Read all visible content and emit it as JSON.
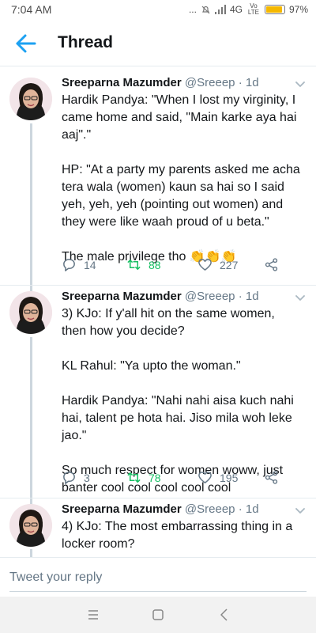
{
  "status_bar": {
    "time": "7:04 AM",
    "indicators": "... ",
    "network": "4G",
    "volte": "Vo LTE",
    "battery_percent": "97%",
    "battery_level": 0.97
  },
  "header": {
    "title": "Thread",
    "back_icon": "arrow-left-icon"
  },
  "tweets": [
    {
      "name": "Sreeparna Mazumder",
      "handle": "@Sreeep",
      "time": "· 1d",
      "paragraphs": [
        "Hardik Pandya: \"When I lost my virginity, I came home and said, \"Main karke aya hai aaj\".\"",
        "HP: \"At a party my parents asked me acha tera wala (women) kaun sa hai so I said yeh, yeh, yeh (pointing out women) and they were like waah proud of u beta.\"",
        "The male privilege tho 👏👏👏"
      ],
      "replies": "14",
      "retweets": "88",
      "likes": "227"
    },
    {
      "name": "Sreeparna Mazumder",
      "handle": "@Sreeep",
      "time": "· 1d",
      "paragraphs": [
        "3) KJo: If y'all hit on the same women, then how you decide?",
        "KL Rahul: \"Ya upto the woman.\"",
        "Hardik Pandya: \"Nahi nahi aisa kuch nahi hai, talent pe hota hai. Jiso mila woh leke jao.\"",
        "So much respect for women woww, just banter cool cool cool cool cool"
      ],
      "replies": "3",
      "retweets": "78",
      "likes": "195"
    },
    {
      "name": "Sreeparna Mazumder",
      "handle": "@Sreeep",
      "time": "· 1d",
      "paragraphs": [
        "4) KJo: The most embarrassing thing in a locker room?"
      ]
    }
  ],
  "reply_box": {
    "placeholder": "Tweet your reply"
  },
  "colors": {
    "accent": "#1da1f2",
    "retweet_green": "#17bf63",
    "secondary_text": "#657786",
    "thread_line": "#ccd6dd"
  }
}
